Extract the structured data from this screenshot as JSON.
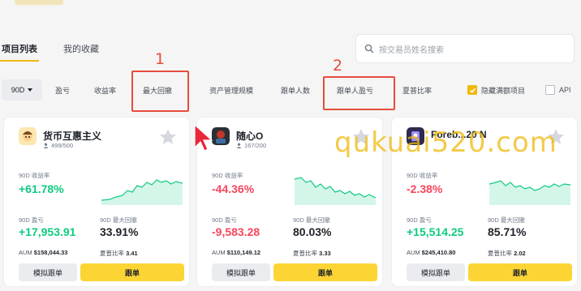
{
  "tabs": [
    {
      "label": "项目列表",
      "active": true
    },
    {
      "label": "我的收藏",
      "active": false
    }
  ],
  "search": {
    "placeholder": "按交易员姓名搜索"
  },
  "sortbar": {
    "period": "90D",
    "items": [
      "盈亏",
      "收益率",
      "最大回撤",
      "资产管理规模",
      "跟单人数",
      "跟单人盈亏",
      "夏普比率"
    ],
    "hide_full_label": "隐藏满额项目",
    "hide_full_checked": true,
    "api_label": "API",
    "api_checked": false
  },
  "annotations": {
    "mark1": "1",
    "mark2": "2"
  },
  "watermark": "qukuai520.com",
  "labels": {
    "roi": "90D 收益率",
    "pnl": "90D 盈亏",
    "mdd": "90D 最大回撤",
    "aum": "AUM",
    "sharpe": "夏普比率",
    "simulate": "模拟跟单",
    "copy": "跟单"
  },
  "colors": {
    "accent": "#fcd535",
    "up": "#0ecb81",
    "down": "#f6465d",
    "highlight": "#e74c3c"
  },
  "cards": [
    {
      "name": "货币互惠主义",
      "seats": "499/500",
      "roi": "+61.78%",
      "pnl": "+17,953.91",
      "mdd": "33.91%",
      "aum": "$158,044.33",
      "sharpe": "3.41",
      "trend": "up"
    },
    {
      "name": "随心O",
      "seats": "167/200",
      "roi": "-44.36%",
      "pnl": "-9,583.28",
      "mdd": "80.03%",
      "aum": "$110,149.12",
      "sharpe": "3.33",
      "trend": "down"
    },
    {
      "name": "Foreb...20 N",
      "seats": "",
      "roi": "-2.38%",
      "pnl": "+15,514.25",
      "mdd": "85.71%",
      "aum": "$245,410.80",
      "sharpe": "2.02",
      "trend": "flat"
    }
  ]
}
